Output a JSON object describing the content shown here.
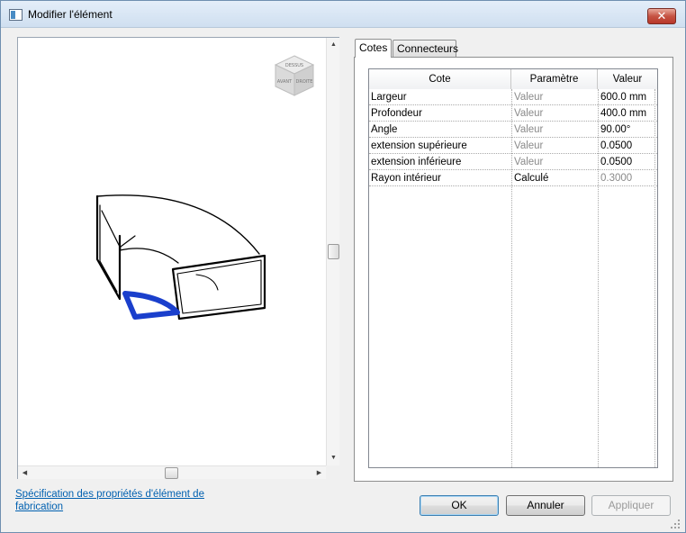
{
  "window": {
    "title": "Modifier l'élément",
    "close_glyph": "✕"
  },
  "preview": {
    "viewcube_labels": [
      "DESSUS",
      "AVANT",
      "DROITE"
    ]
  },
  "tabs": [
    {
      "label": "Cotes",
      "active": true
    },
    {
      "label": "Connecteurs",
      "active": false
    }
  ],
  "grid": {
    "columns": [
      "Cote",
      "Paramètre",
      "Valeur"
    ],
    "rows": [
      {
        "cote": "Largeur",
        "parametre": "Valeur",
        "valeur": "600.0 mm"
      },
      {
        "cote": "Profondeur",
        "parametre": "Valeur",
        "valeur": "400.0 mm"
      },
      {
        "cote": "Angle",
        "parametre": "Valeur",
        "valeur": "90.00°"
      },
      {
        "cote": "extension supérieure",
        "parametre": "Valeur",
        "valeur": "0.0500"
      },
      {
        "cote": "extension inférieure",
        "parametre": "Valeur",
        "valeur": "0.0500"
      },
      {
        "cote": "Rayon intérieur",
        "parametre": "Calculé",
        "valeur": "0.3000"
      }
    ]
  },
  "link": {
    "text": "Spécification des propriétés d'élément de fabrication"
  },
  "buttons": {
    "ok": "OK",
    "cancel": "Annuler",
    "apply": "Appliquer"
  },
  "colors": {
    "selection": "#1a3fcc",
    "link": "#0060b0"
  }
}
